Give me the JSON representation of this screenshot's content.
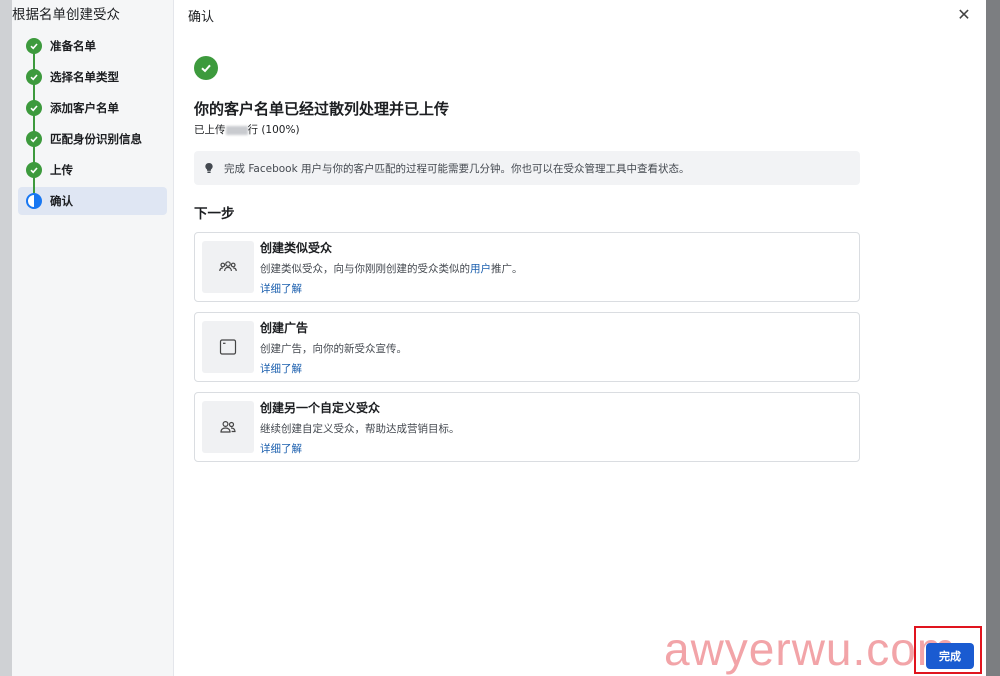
{
  "sidebar": {
    "title": "根据名单创建受众",
    "steps": [
      {
        "label": "准备名单",
        "state": "done"
      },
      {
        "label": "选择名单类型",
        "state": "done"
      },
      {
        "label": "添加客户名单",
        "state": "done"
      },
      {
        "label": "匹配身份识别信息",
        "state": "done"
      },
      {
        "label": "上传",
        "state": "done"
      },
      {
        "label": "确认",
        "state": "current"
      }
    ]
  },
  "header": {
    "title": "确认",
    "close_icon": "close-icon"
  },
  "result": {
    "headline": "你的客户名单已经过散列处理并已上传",
    "uploaded_prefix": "已上传",
    "uploaded_suffix": "行 (100%)"
  },
  "notice": {
    "text": "完成 Facebook 用户与你的客户匹配的过程可能需要几分钟。你也可以在受众管理工具中查看状态。"
  },
  "next": {
    "title": "下一步",
    "cards": [
      {
        "icon": "people-group-icon",
        "title": "创建类似受众",
        "desc_before": "创建类似受众，向与你刚刚创建的受众类似的",
        "desc_link": "用户",
        "desc_after": "推广。",
        "link": "详细了解"
      },
      {
        "icon": "browser-window-icon",
        "title": "创建广告",
        "desc_before": "创建广告，向你的新受众宣传。",
        "desc_link": "",
        "desc_after": "",
        "link": "详细了解"
      },
      {
        "icon": "people-pair-icon",
        "title": "创建另一个自定义受众",
        "desc_before": "继续创建自定义受众，帮助达成营销目标。",
        "desc_link": "",
        "desc_after": "",
        "link": "详细了解"
      }
    ]
  },
  "footer": {
    "finish_label": "完成"
  },
  "watermark": {
    "brand": "awyerwu.com"
  },
  "colors": {
    "success": "#3d9a3d",
    "primary": "#1a5bd1",
    "link": "#1b5fae",
    "highlight": "#e0141e"
  }
}
